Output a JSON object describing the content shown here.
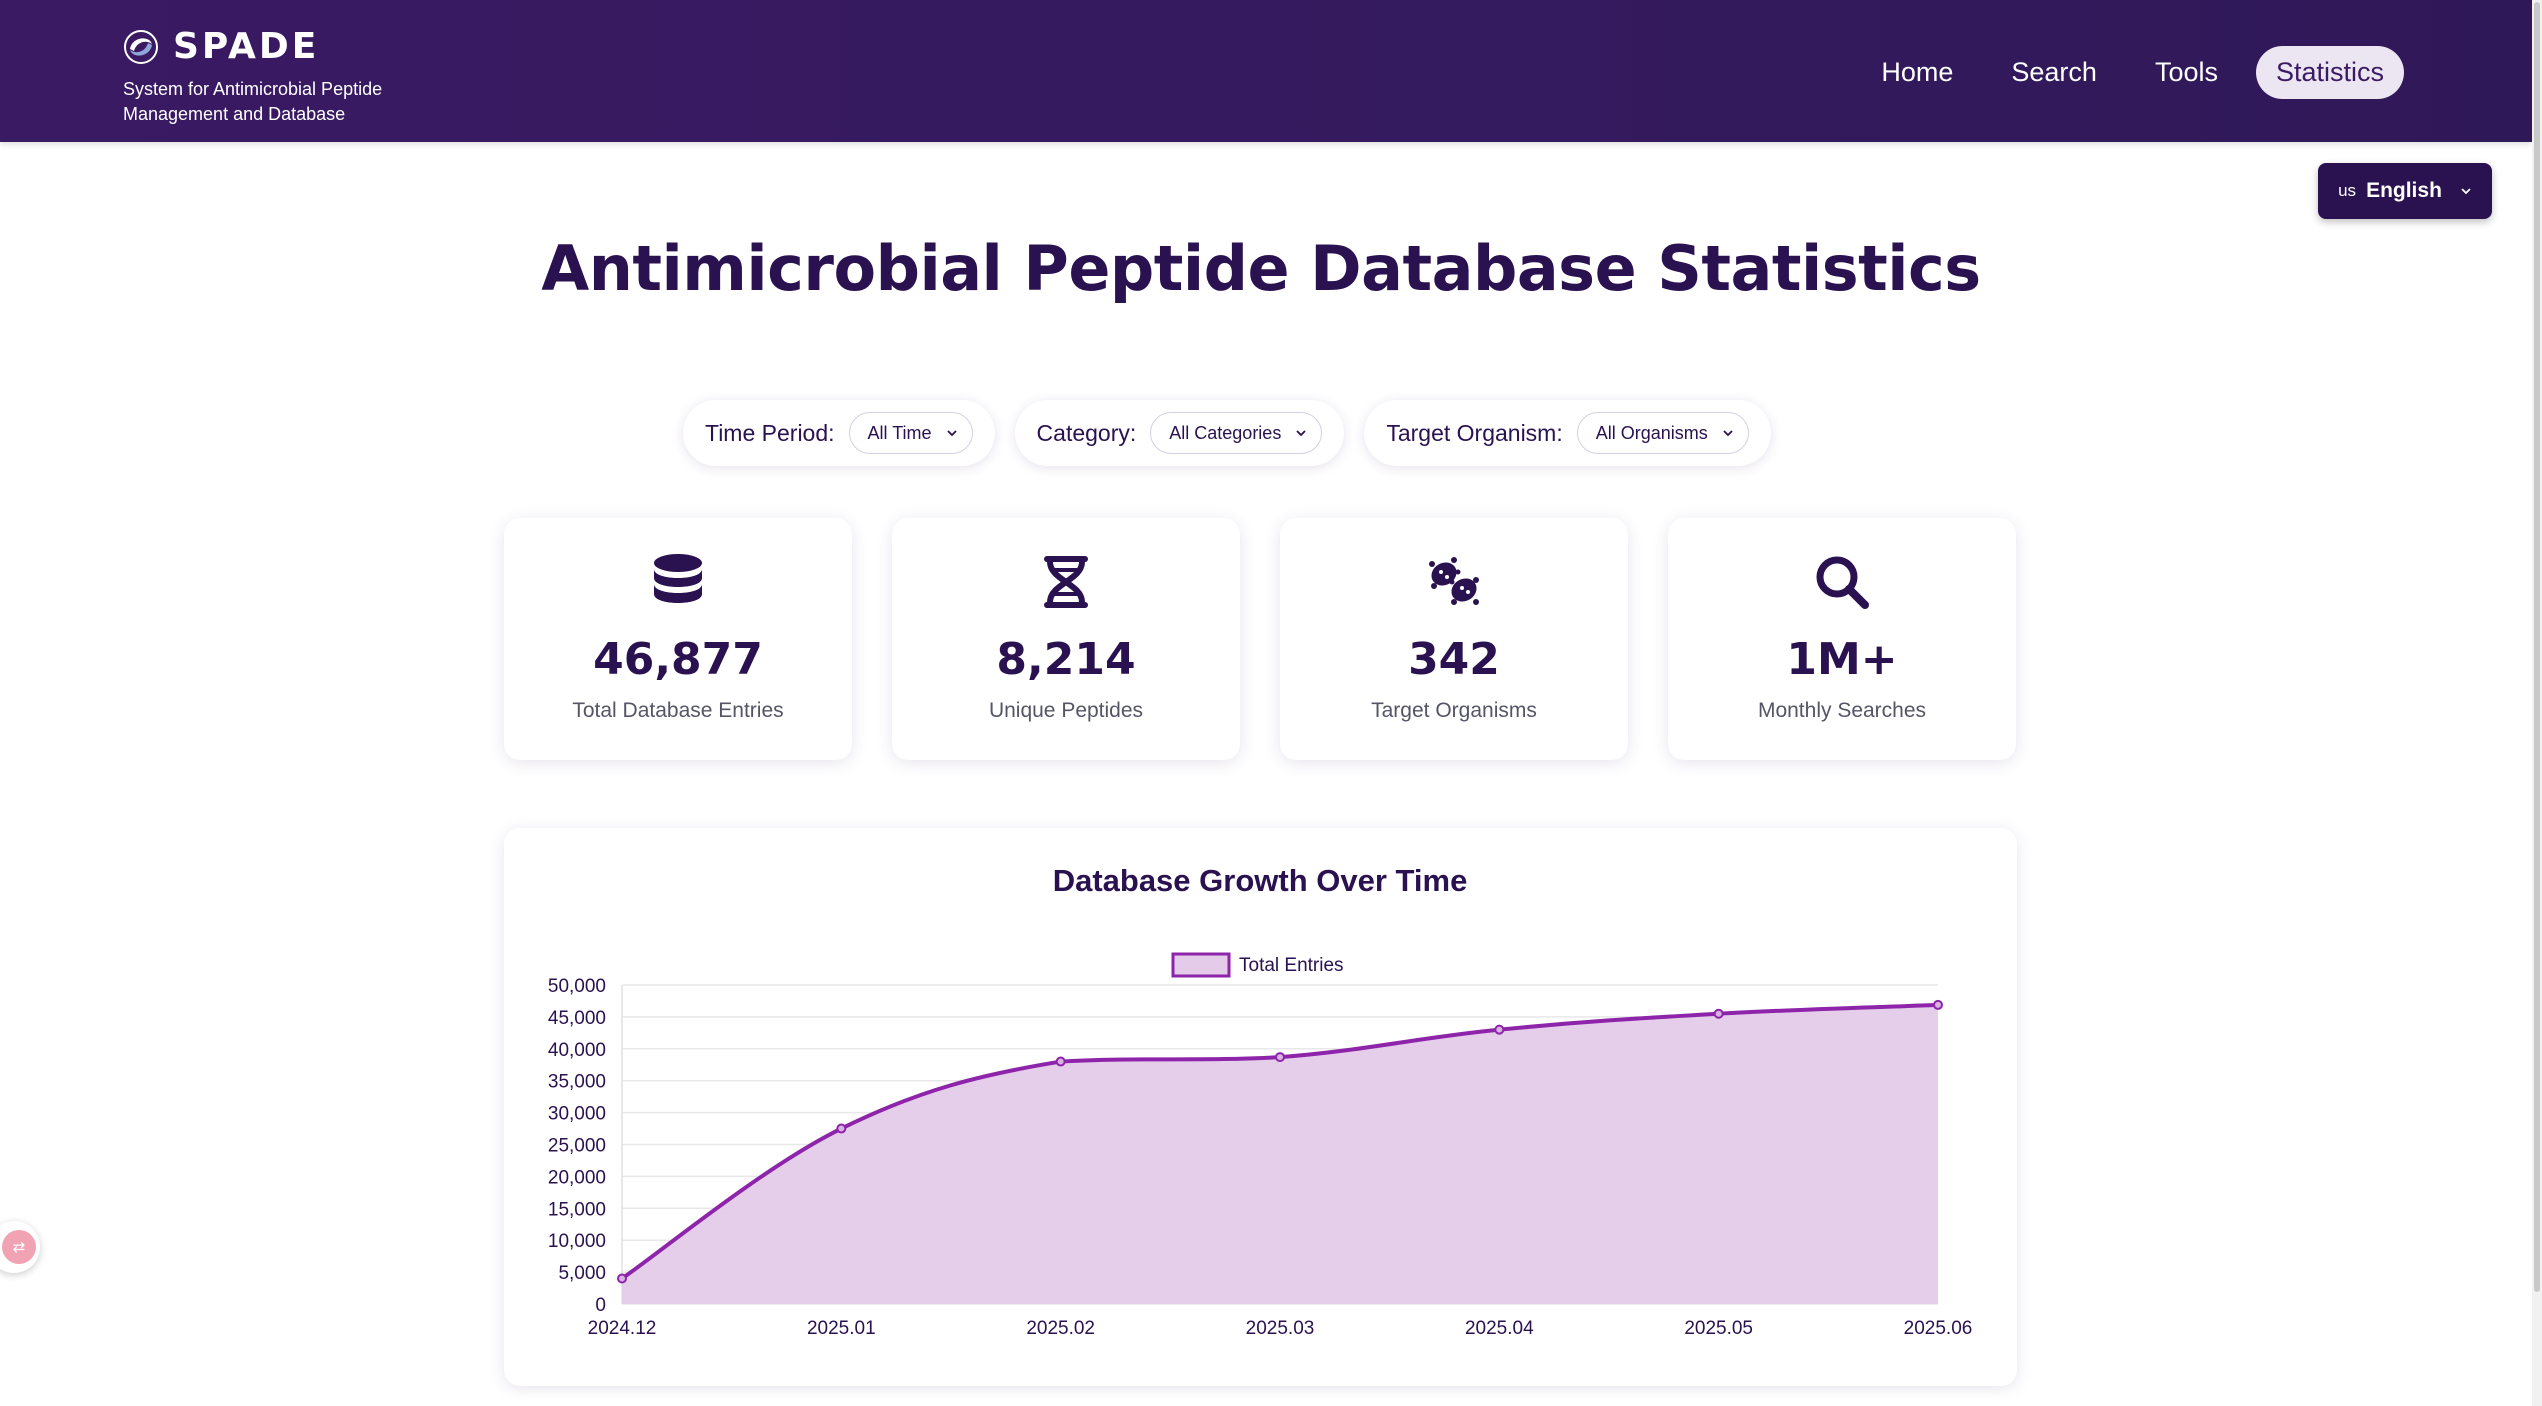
{
  "brand": {
    "name": "SPADE",
    "subtitle": "System for Antimicrobial Peptide Management and Database"
  },
  "nav": {
    "items": [
      {
        "label": "Home",
        "active": false
      },
      {
        "label": "Search",
        "active": false
      },
      {
        "label": "Tools",
        "active": false
      },
      {
        "label": "Statistics",
        "active": true
      }
    ]
  },
  "language": {
    "flag": "us",
    "label": "English"
  },
  "page": {
    "title": "Antimicrobial Peptide Database Statistics"
  },
  "filters": [
    {
      "label": "Time Period:",
      "value": "All Time"
    },
    {
      "label": "Category:",
      "value": "All Categories"
    },
    {
      "label": "Target Organism:",
      "value": "All Organisms"
    }
  ],
  "stats": [
    {
      "icon": "database-icon",
      "value": "46,877",
      "label": "Total Database Entries"
    },
    {
      "icon": "dna-icon",
      "value": "8,214",
      "label": "Unique Peptides"
    },
    {
      "icon": "bacteria-icon",
      "value": "342",
      "label": "Target Organisms"
    },
    {
      "icon": "search-icon",
      "value": "1M+",
      "label": "Monthly Searches"
    }
  ],
  "colors": {
    "header_bg": "#3a1a63",
    "primary_text": "#2a1150",
    "line": "#8e24aa",
    "fill": "#e3cbe9"
  },
  "chart_data": {
    "type": "area",
    "title": "Database Growth Over Time",
    "categories": [
      "2024.12",
      "2025.01",
      "2025.02",
      "2025.03",
      "2025.04",
      "2025.05",
      "2025.06"
    ],
    "series": [
      {
        "name": "Total Entries",
        "values": [
          4000,
          27500,
          38000,
          38700,
          43000,
          45500,
          46877
        ]
      }
    ],
    "ylim": [
      0,
      50000
    ],
    "yticks": [
      0,
      5000,
      10000,
      15000,
      20000,
      25000,
      30000,
      35000,
      40000,
      45000,
      50000
    ],
    "ytick_labels": [
      "0",
      "5,000",
      "10,000",
      "15,000",
      "20,000",
      "25,000",
      "30,000",
      "35,000",
      "40,000",
      "45,000",
      "50,000"
    ],
    "grid": true,
    "legend": "top-center",
    "smooth": true
  }
}
